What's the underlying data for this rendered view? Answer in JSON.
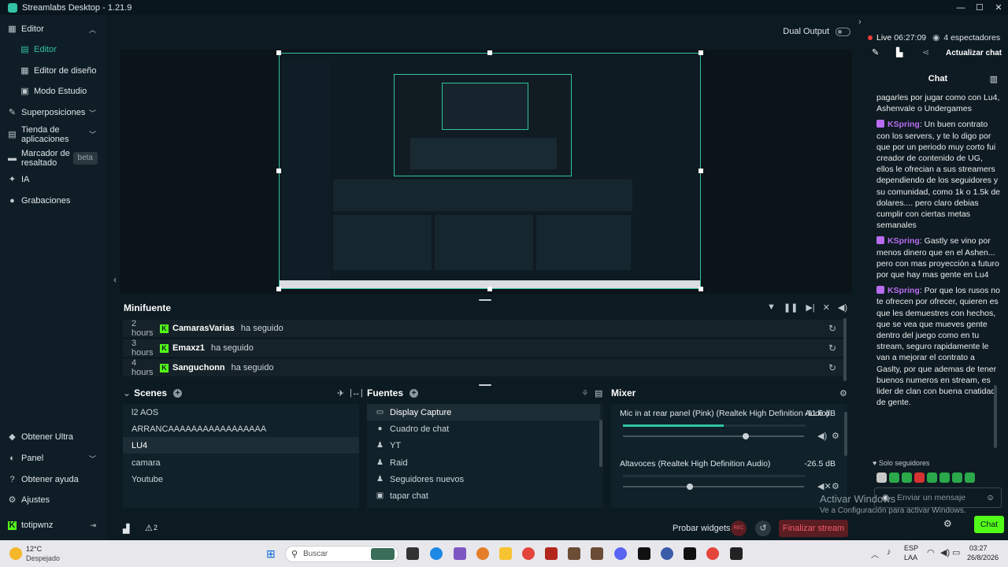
{
  "window": {
    "title": "Streamlabs Desktop - 1.21.9",
    "controls": [
      "—",
      "☐",
      "✕"
    ]
  },
  "sidebar": {
    "items": [
      {
        "label": "Editor",
        "icon": "editor-icon",
        "expanded": true
      },
      {
        "label": "Editor",
        "icon": "editor-sub-icon",
        "active": true
      },
      {
        "label": "Editor de diseño",
        "icon": "layout-icon"
      },
      {
        "label": "Modo Estudio",
        "icon": "studio-icon"
      },
      {
        "label": "Superposiciones",
        "icon": "overlays-icon"
      },
      {
        "label": "Tienda de aplicaciones",
        "icon": "store-icon"
      },
      {
        "label": "Marcador de resaltado",
        "icon": "highlighter-icon",
        "badge": "beta"
      },
      {
        "label": "IA",
        "icon": "ai-icon"
      },
      {
        "label": "Grabaciones",
        "icon": "recordings-icon"
      }
    ],
    "bottom": [
      {
        "label": "Obtener Ultra",
        "icon": "ultra-icon"
      },
      {
        "label": "Panel",
        "icon": "dashboard-icon"
      },
      {
        "label": "Obtener ayuda",
        "icon": "help-icon"
      },
      {
        "label": "Ajustes",
        "icon": "settings-icon"
      },
      {
        "label": "totipwnz",
        "icon": "kick-logo-icon"
      }
    ]
  },
  "editor": {
    "dual_output": "Dual Output",
    "minifuente": {
      "title": "Minifuente",
      "events": [
        {
          "time": "2 hours",
          "user": "CamarasVarias",
          "action": "ha seguido"
        },
        {
          "time": "3 hours",
          "user": "Emaxz1",
          "action": "ha seguido"
        },
        {
          "time": "4 hours",
          "user": "Sanguchonn",
          "action": "ha seguido"
        }
      ]
    },
    "scenes": {
      "title": "Scenes",
      "items": [
        "l2 AOS",
        "ARRANCAAAAAAAAAAAAAAAAA",
        "LU4",
        "camara",
        "Youtube"
      ],
      "selected": 2
    },
    "sources": {
      "title": "Fuentes",
      "items": [
        {
          "label": "Display Capture",
          "icon": "monitor-icon"
        },
        {
          "label": "Cuadro de chat",
          "icon": "chat-bubble-icon"
        },
        {
          "label": "YT",
          "icon": "user-icon"
        },
        {
          "label": "Raid",
          "icon": "user-icon"
        },
        {
          "label": "Seguidores nuevos",
          "icon": "user-icon"
        },
        {
          "label": "tapar chat",
          "icon": "image-icon"
        }
      ],
      "selected": 0
    },
    "mixer": {
      "title": "Mixer",
      "items": [
        {
          "label": "Mic in at rear panel (Pink) (Realtek High Definition Audio)",
          "db": "-11.6 dB",
          "level": 0.55,
          "volume": 0.68
        },
        {
          "label": "Altavoces (Realtek High Definition Audio)",
          "db": "-26.5 dB",
          "level": 0.0,
          "volume": 0.37
        }
      ]
    },
    "footer": {
      "alerts": "2",
      "test_widgets": "Probar widgets",
      "rec": "REC",
      "end_stream": "Finalizar stream"
    }
  },
  "chat": {
    "live": "Live",
    "uptime": "06:27:09",
    "viewers": "4 espectadores",
    "refresh": "Actualizar chat",
    "title": "Chat",
    "messages": [
      {
        "user": "",
        "text": "pagarles por jugar como con Lu4, Ashenvale o Undergames"
      },
      {
        "user": "KSpring",
        "text": ": Un buen contrato con los servers, y te lo digo por que por un periodo muy corto fui creador de contenido de UG, ellos le ofrecian a sus streamers dependiendo de los seguidores y su comunidad, como 1k o 1.5k de dolares.... pero claro debias cumplir con ciertas metas semanales"
      },
      {
        "user": "KSpring",
        "text": ": Gastly se vino por menos dinero que en el Ashen... pero con mas proyección a futuro por que hay mas gente en Lu4"
      },
      {
        "user": "KSpring",
        "text": ": Por que los rusos no te ofrecen por ofrecer, quieren es que les demuestres con hechos, que se vea que mueves gente dentro del juego como en tu stream, seguro rapidamente le van a mejorar el contrato a Gaslty, por que ademas de tener buenos numeros en stream, es lider de clan con buena cnatidad de gente."
      }
    ],
    "followers_only": "Solo seguidores",
    "input_placeholder": "Enviar un mensaje",
    "send": "Chat"
  },
  "watermark": {
    "line1": "Activar Windows",
    "line2": "Ve a Configuración para activar Windows."
  },
  "taskbar": {
    "weather_temp": "12°C",
    "weather_desc": "Despejado",
    "search": "Buscar",
    "lang": "ESP",
    "lang2": "LAA",
    "time": "03:27",
    "date": "26/8/2026"
  }
}
